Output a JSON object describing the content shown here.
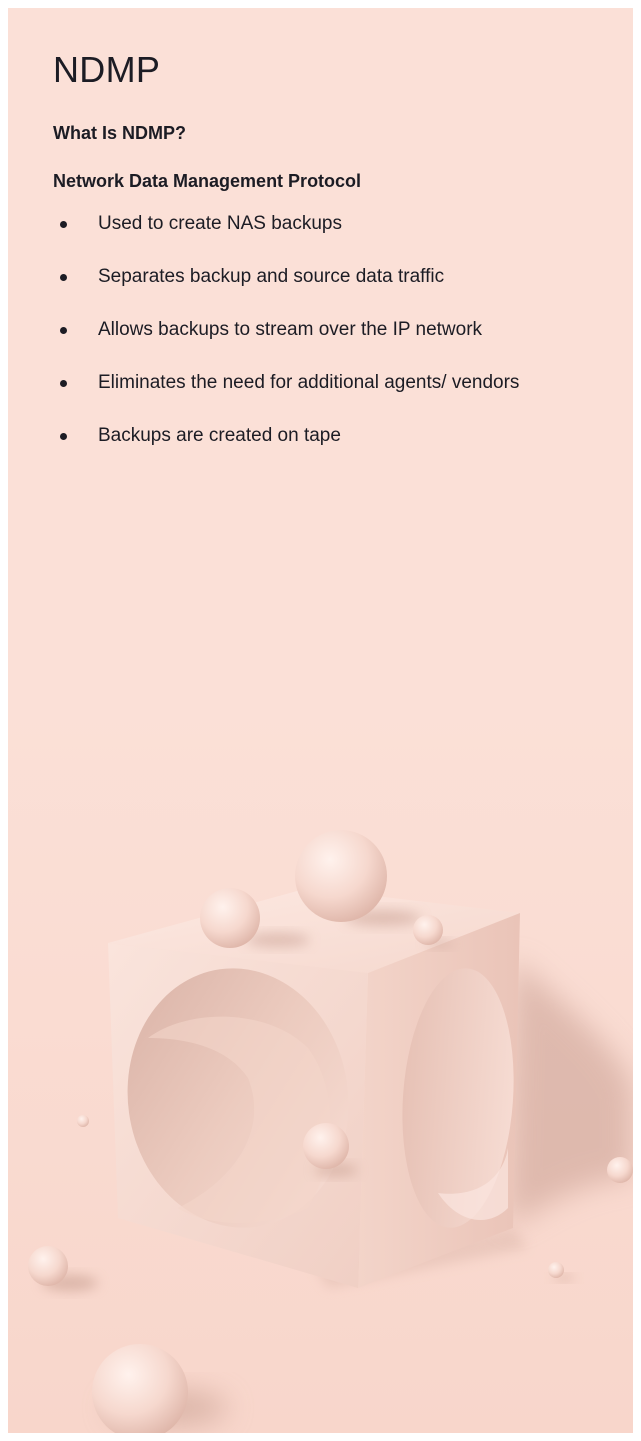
{
  "slide": {
    "title": "NDMP",
    "subtitle": "What Is NDMP?",
    "heading": "Network Data Management Protocol",
    "bullets": [
      "Used to create NAS backups",
      "Separates backup and source data traffic",
      "Allows backups to stream over the IP network",
      "Eliminates the need for additional agents/ vendors",
      "Backups are created on tape"
    ]
  },
  "colors": {
    "background": "#fbe0d7",
    "text": "#1c1c24",
    "illustration_light": "#fbe4dc",
    "illustration_shadow": "#c9a79c"
  },
  "illustration": {
    "icon": "cube-with-spheres-illustration"
  }
}
